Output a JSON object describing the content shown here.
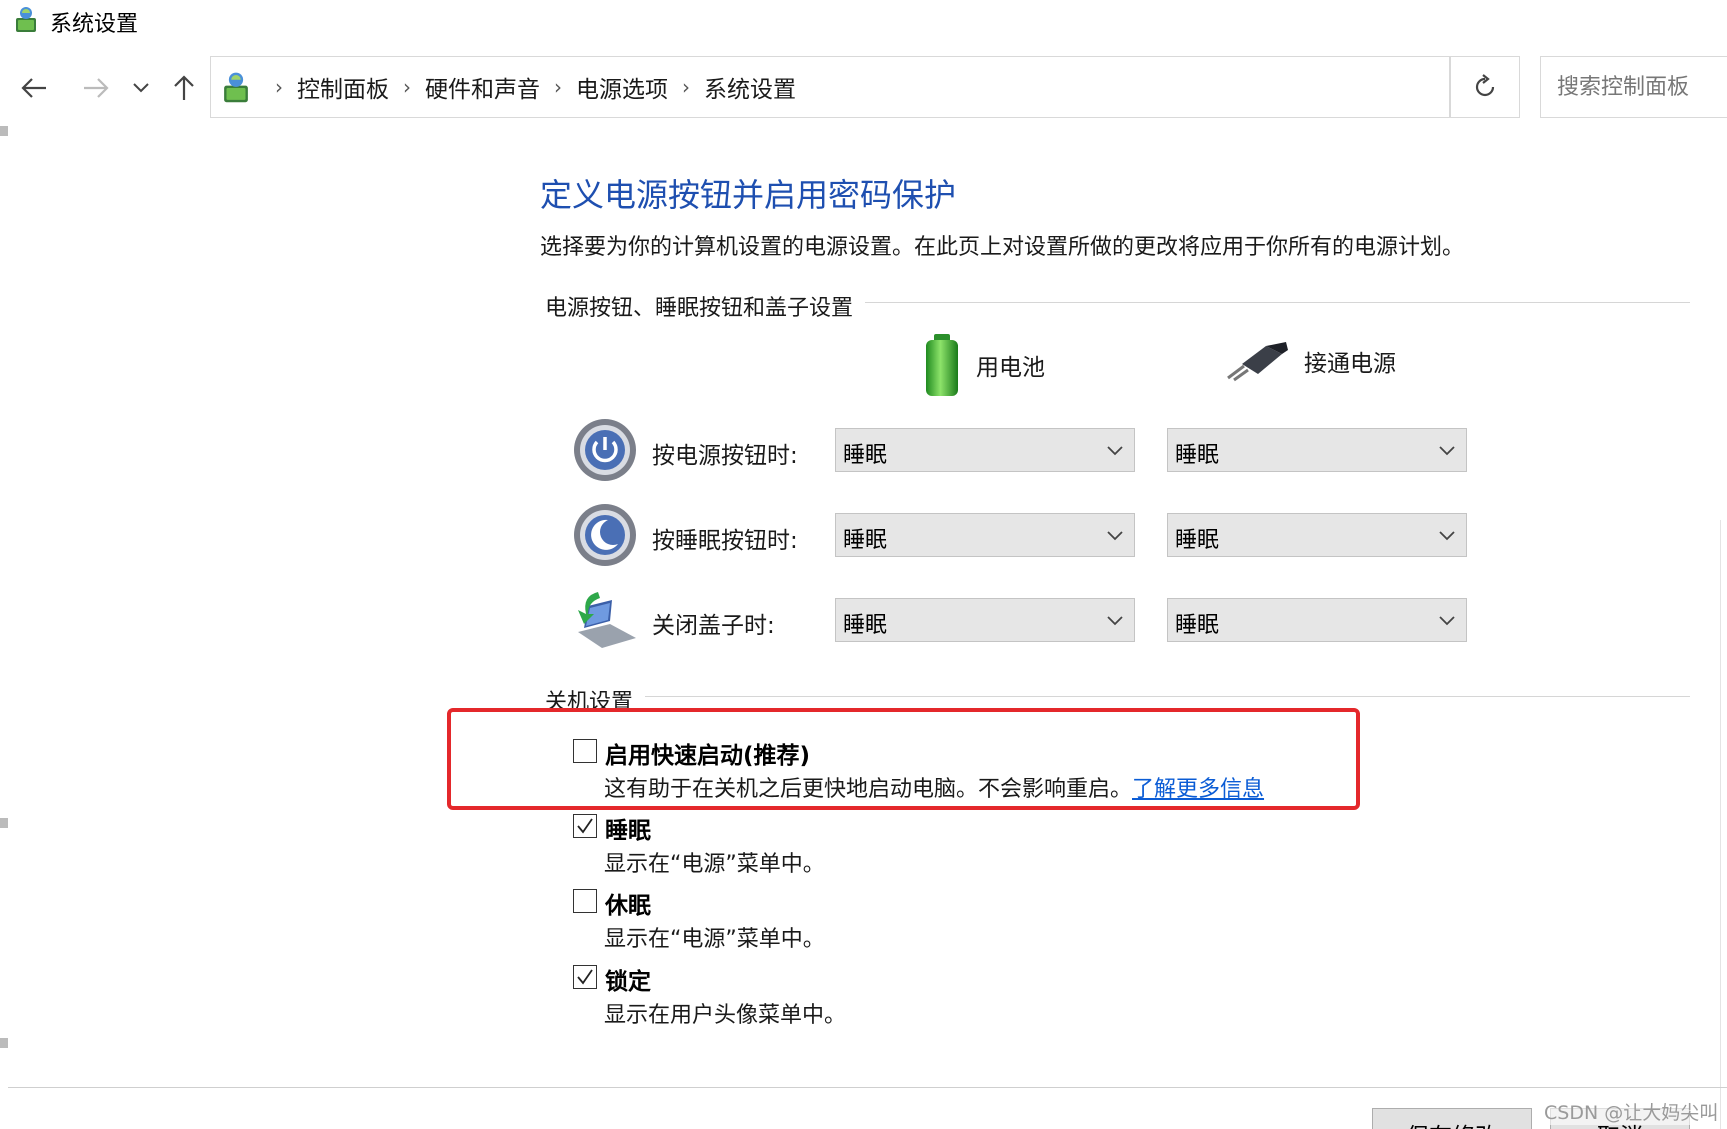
{
  "window": {
    "title": "系统设置"
  },
  "nav": {
    "breadcrumbs": [
      "控制面板",
      "硬件和声音",
      "电源选项",
      "系统设置"
    ],
    "search_placeholder": "搜索控制面板"
  },
  "page": {
    "heading": "定义电源按钮并启用密码保护",
    "description": "选择要为你的计算机设置的电源设置。在此页上对设置所做的更改将应用于你所有的电源计划。"
  },
  "power_buttons": {
    "section_title": "电源按钮、睡眠按钮和盖子设置",
    "columns": {
      "battery": "用电池",
      "plugged": "接通电源"
    },
    "rows": [
      {
        "label": "按电源按钮时:",
        "battery_value": "睡眠",
        "plugged_value": "睡眠",
        "icon": "power-icon"
      },
      {
        "label": "按睡眠按钮时:",
        "battery_value": "睡眠",
        "plugged_value": "睡眠",
        "icon": "sleep-icon"
      },
      {
        "label": "关闭盖子时:",
        "battery_value": "睡眠",
        "plugged_value": "睡眠",
        "icon": "laptop-lid-icon"
      }
    ]
  },
  "shutdown": {
    "section_title": "关机设置",
    "options": [
      {
        "title": "启用快速启动(推荐)",
        "desc": "这有助于在关机之后更快地启动电脑。不会影响重启。",
        "link": "了解更多信息",
        "checked": false
      },
      {
        "title": "睡眠",
        "desc": "显示在“电源”菜单中。",
        "checked": true
      },
      {
        "title": "休眠",
        "desc": "显示在“电源”菜单中。",
        "checked": false
      },
      {
        "title": "锁定",
        "desc": "显示在用户头像菜单中。",
        "checked": true
      }
    ]
  },
  "footer": {
    "save_label": "保存修改",
    "cancel_label": "取消",
    "watermark": "CSDN @让大妈尖叫"
  },
  "colors": {
    "heading": "#1e4fb0",
    "link": "#0b5cd5",
    "highlight": "#e4282b",
    "select_bg": "#e6e6e6"
  }
}
